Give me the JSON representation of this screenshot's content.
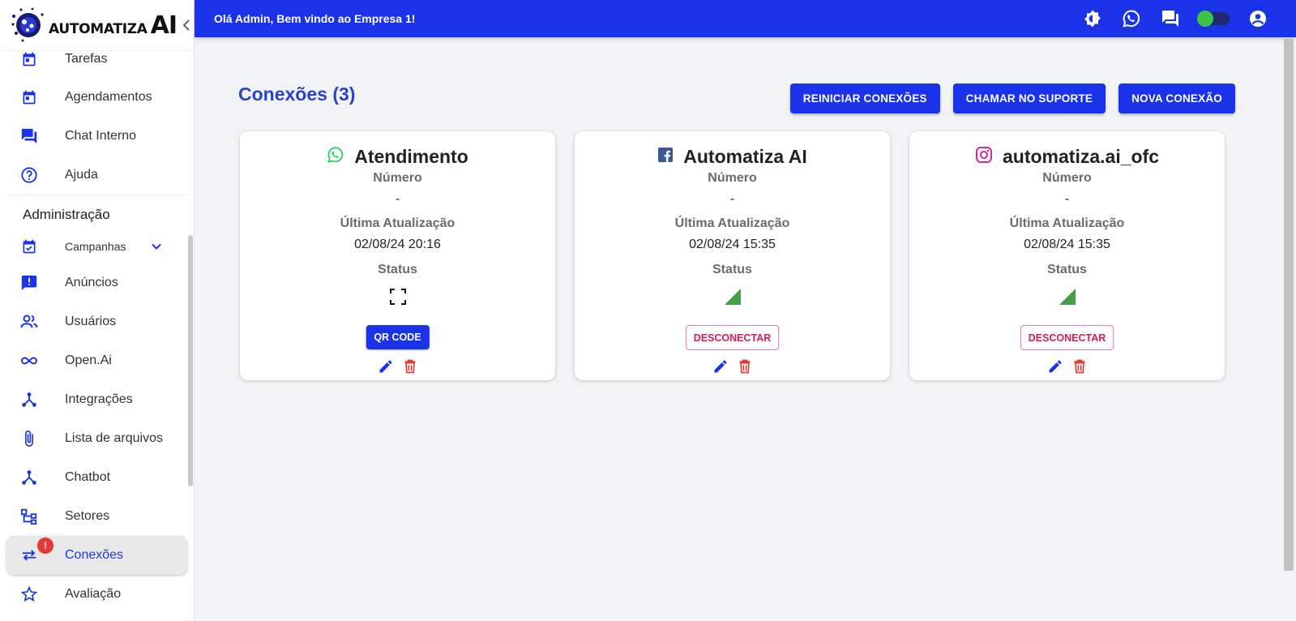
{
  "brand": {
    "logo_word": "AUTOMATIZA",
    "logo_ai": "AI"
  },
  "topbar": {
    "greeting": "Olá Admin, Bem vindo ao Empresa 1!"
  },
  "sidebar": {
    "items_top": [
      {
        "label": "Tarefas",
        "icon": "calendar-icon"
      },
      {
        "label": "Agendamentos",
        "icon": "calendar-icon"
      },
      {
        "label": "Chat Interno",
        "icon": "forum-icon"
      },
      {
        "label": "Ajuda",
        "icon": "help-icon"
      }
    ],
    "section_admin": "Administração",
    "items_admin": [
      {
        "label": "Campanhas",
        "icon": "event-available-icon"
      },
      {
        "label": "Anúncios",
        "icon": "announcement-icon"
      },
      {
        "label": "Usuários",
        "icon": "people-icon"
      },
      {
        "label": "Open.Ai",
        "icon": "infinity-icon"
      },
      {
        "label": "Integrações",
        "icon": "hub-icon"
      },
      {
        "label": "Lista de arquivos",
        "icon": "attach-icon"
      },
      {
        "label": "Chatbot",
        "icon": "hub-icon"
      },
      {
        "label": "Setores",
        "icon": "account-tree-icon"
      },
      {
        "label": "Conexões",
        "icon": "sync-alt-icon",
        "active": true,
        "badge": "!"
      },
      {
        "label": "Avaliação",
        "icon": "star-icon"
      }
    ]
  },
  "page": {
    "title": "Conexões (3)"
  },
  "actions": {
    "restart": "REINICIAR CONEXÕES",
    "support": "CHAMAR NO SUPORTE",
    "new": "NOVA CONEXÃO"
  },
  "labels": {
    "number": "Número",
    "updated": "Última Atualização",
    "status": "Status",
    "qr": "QR CODE",
    "disconnect": "DESCONECTAR"
  },
  "connections": [
    {
      "name": "Atendimento",
      "channel": "whatsapp",
      "number": "-",
      "updated": "02/08/24 20:16",
      "status": "qrcode"
    },
    {
      "name": "Automatiza AI",
      "channel": "facebook",
      "number": "-",
      "updated": "02/08/24 15:35",
      "status": "connected"
    },
    {
      "name": "automatiza.ai_ofc",
      "channel": "instagram",
      "number": "-",
      "updated": "02/08/24 15:35",
      "status": "connected"
    }
  ],
  "colors": {
    "primary": "#1a32e8",
    "title": "#2a44c9",
    "danger": "#d81b60",
    "delete": "#e53935",
    "signal": "#43a047",
    "whatsapp": "#25d366",
    "facebook": "#3b5998",
    "instagram": "#d6249f"
  }
}
